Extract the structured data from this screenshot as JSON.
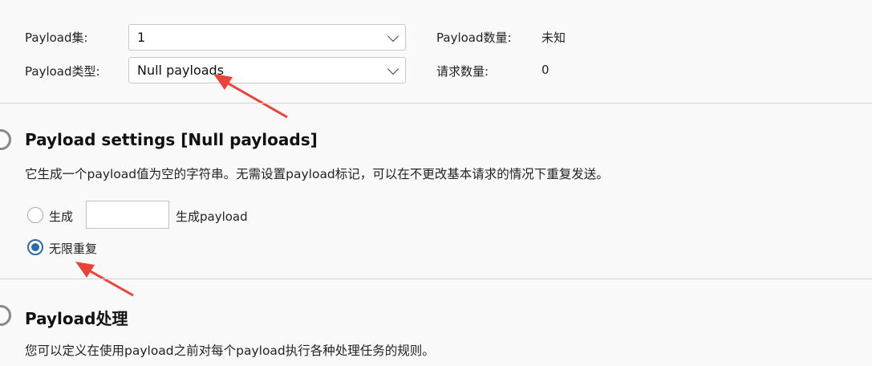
{
  "payload_set": {
    "label": "Payload集:",
    "value": "1",
    "count_label": "Payload数量:",
    "count_value": "未知"
  },
  "payload_type": {
    "label": "Payload类型:",
    "value": "Null payloads",
    "request_label": "请求数量:",
    "request_value": "0"
  },
  "settings": {
    "title": "Payload settings [Null payloads]",
    "description": "它生成一个payload值为空的字符串。无需设置payload标记，可以在不更改基本请求的情况下重复发送。",
    "generate_label": "生成",
    "generate_value": "",
    "generate_suffix": "生成payload",
    "infinite_label": "无限重复",
    "selected": "infinite"
  },
  "processing": {
    "title": "Payload处理",
    "description": "您可以定义在使用payload之前对每个payload执行各种处理任务的规则。"
  },
  "colors": {
    "accent": "#2b6aa8",
    "annotation": "#e8443a"
  }
}
